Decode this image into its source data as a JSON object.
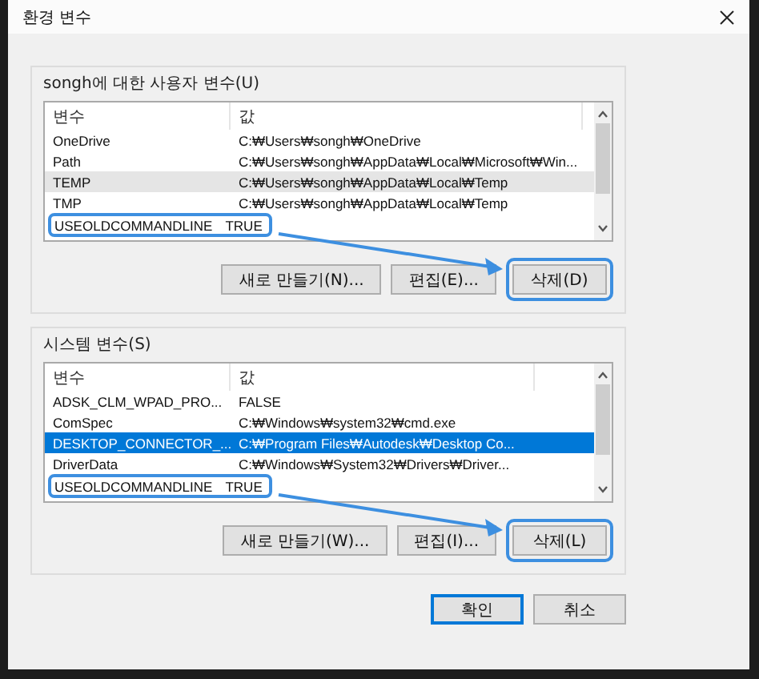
{
  "window": {
    "title": "환경 변수"
  },
  "sections": [
    {
      "label": "songh에 대한 사용자 변수(U)",
      "columns": [
        "변수",
        "값"
      ],
      "rows": [
        {
          "name": "OneDrive",
          "value": "C:₩Users₩songh₩OneDrive",
          "selected": false,
          "hovered": false,
          "annotated": false
        },
        {
          "name": "Path",
          "value": "C:₩Users₩songh₩AppData₩Local₩Microsoft₩Win...",
          "selected": false,
          "hovered": false,
          "annotated": false
        },
        {
          "name": "TEMP",
          "value": "C:₩Users₩songh₩AppData₩Local₩Temp",
          "selected": false,
          "hovered": true,
          "annotated": false
        },
        {
          "name": "TMP",
          "value": "C:₩Users₩songh₩AppData₩Local₩Temp",
          "selected": false,
          "hovered": false,
          "annotated": false
        },
        {
          "name": "USEOLDCOMMANDLINE",
          "value": "TRUE",
          "selected": false,
          "hovered": false,
          "annotated": true
        }
      ],
      "buttons": [
        {
          "label": "새로 만들기(N)...",
          "annotated": false
        },
        {
          "label": "편집(E)...",
          "annotated": false
        },
        {
          "label": "삭제(D)",
          "annotated": true
        }
      ]
    },
    {
      "label": "시스템 변수(S)",
      "columns": [
        "변수",
        "값"
      ],
      "rows": [
        {
          "name": "ADSK_CLM_WPAD_PRO...",
          "value": "FALSE",
          "selected": false,
          "hovered": false,
          "annotated": false
        },
        {
          "name": "ComSpec",
          "value": "C:₩Windows₩system32₩cmd.exe",
          "selected": false,
          "hovered": false,
          "annotated": false
        },
        {
          "name": "DESKTOP_CONNECTOR_...",
          "value": "C:₩Program Files₩Autodesk₩Desktop Co...",
          "selected": true,
          "hovered": false,
          "annotated": false
        },
        {
          "name": "DriverData",
          "value": "C:₩Windows₩System32₩Drivers₩Driver...",
          "selected": false,
          "hovered": false,
          "annotated": false
        },
        {
          "name": "USEOLDCOMMANDLINE",
          "value": "TRUE",
          "selected": false,
          "hovered": false,
          "annotated": true
        }
      ],
      "buttons": [
        {
          "label": "새로 만들기(W)...",
          "annotated": false
        },
        {
          "label": "편집(I)...",
          "annotated": false
        },
        {
          "label": "삭제(L)",
          "annotated": true
        }
      ]
    }
  ],
  "footer_buttons": [
    {
      "label": "확인",
      "default": true
    },
    {
      "label": "취소",
      "default": false
    }
  ]
}
